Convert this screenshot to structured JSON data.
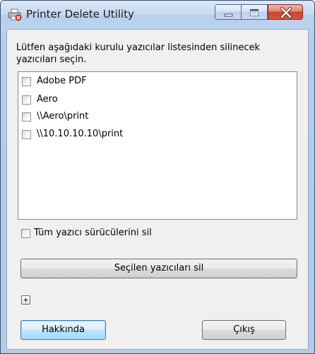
{
  "window": {
    "title": "Printer Delete Utility"
  },
  "main": {
    "instruction": "Lütfen aşağıdaki kurulu yazıcılar listesinden silinecek yazıcıları seçin.",
    "printers": [
      {
        "label": "Adobe PDF",
        "checked": false
      },
      {
        "label": "Aero",
        "checked": false
      },
      {
        "label": "\\\\Aero\\print",
        "checked": false
      },
      {
        "label": "\\\\10.10.10.10\\print",
        "checked": false
      }
    ],
    "delete_drivers_label": "Tüm yazıcı sürücülerini sil",
    "delete_drivers_checked": false,
    "remove_button_label": "Seçilen yazıcıları sil",
    "expander_symbol": "+"
  },
  "footer": {
    "about_label": "Hakkında",
    "exit_label": "Çıkış"
  },
  "icons": {
    "title": "printer-delete-icon",
    "minimize": "minimize-icon",
    "maximize": "maximize-icon",
    "close": "close-icon"
  },
  "colors": {
    "title_bar": "#c5d9f1",
    "close_button": "#c64630",
    "focus_button": "#3c7fb1"
  }
}
